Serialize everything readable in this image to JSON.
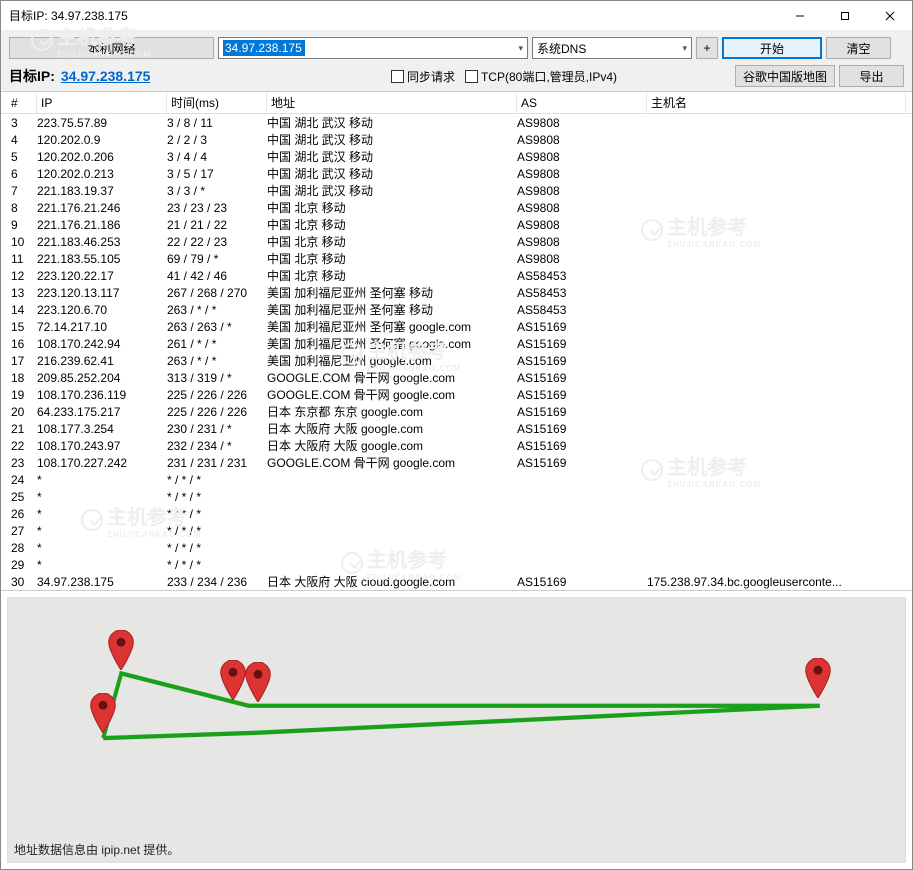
{
  "window": {
    "title": "目标IP: 34.97.238.175"
  },
  "toolbar": {
    "local_network": "本机网络",
    "target_input": "34.97.238.175",
    "dns_setting": "系统DNS",
    "start": "开始",
    "clear": "清空",
    "target_label": "目标IP:",
    "target_ip": "34.97.238.175",
    "sync_request": "同步请求",
    "tcp_option": "TCP(80端口,管理员,IPv4)",
    "google_map": "谷歌中国版地图",
    "export": "导出"
  },
  "columns": {
    "num": "#",
    "ip": "IP",
    "time": "时间(ms)",
    "addr": "地址",
    "as": "AS",
    "host": "主机名"
  },
  "rows": [
    {
      "n": "3",
      "ip": "223.75.57.89",
      "t": "3 / 8 / 11",
      "addr": "中国 湖北 武汉 移动",
      "as": "AS9808",
      "host": ""
    },
    {
      "n": "4",
      "ip": "120.202.0.9",
      "t": "2 / 2 / 3",
      "addr": "中国 湖北 武汉 移动",
      "as": "AS9808",
      "host": ""
    },
    {
      "n": "5",
      "ip": "120.202.0.206",
      "t": "3 / 4 / 4",
      "addr": "中国 湖北 武汉 移动",
      "as": "AS9808",
      "host": ""
    },
    {
      "n": "6",
      "ip": "120.202.0.213",
      "t": "3 / 5 / 17",
      "addr": "中国 湖北 武汉 移动",
      "as": "AS9808",
      "host": ""
    },
    {
      "n": "7",
      "ip": "221.183.19.37",
      "t": "3 / 3 / *",
      "addr": "中国 湖北 武汉 移动",
      "as": "AS9808",
      "host": ""
    },
    {
      "n": "8",
      "ip": "221.176.21.246",
      "t": "23 / 23 / 23",
      "addr": "中国 北京 移动",
      "as": "AS9808",
      "host": ""
    },
    {
      "n": "9",
      "ip": "221.176.21.186",
      "t": "21 / 21 / 22",
      "addr": "中国 北京 移动",
      "as": "AS9808",
      "host": ""
    },
    {
      "n": "10",
      "ip": "221.183.46.253",
      "t": "22 / 22 / 23",
      "addr": "中国 北京 移动",
      "as": "AS9808",
      "host": ""
    },
    {
      "n": "11",
      "ip": "221.183.55.105",
      "t": "69 / 79 / *",
      "addr": "中国 北京 移动",
      "as": "AS9808",
      "host": ""
    },
    {
      "n": "12",
      "ip": "223.120.22.17",
      "t": "41 / 42 / 46",
      "addr": "中国 北京 移动",
      "as": "AS58453",
      "host": ""
    },
    {
      "n": "13",
      "ip": "223.120.13.117",
      "t": "267 / 268 / 270",
      "addr": "美国 加利福尼亚州 圣何塞 移动",
      "as": "AS58453",
      "host": ""
    },
    {
      "n": "14",
      "ip": "223.120.6.70",
      "t": "263 / * / *",
      "addr": "美国 加利福尼亚州 圣何塞 移动",
      "as": "AS58453",
      "host": ""
    },
    {
      "n": "15",
      "ip": "72.14.217.10",
      "t": "263 / 263 / *",
      "addr": "美国 加利福尼亚州 圣何塞 google.com",
      "as": "AS15169",
      "host": ""
    },
    {
      "n": "16",
      "ip": "108.170.242.94",
      "t": "261 / * / *",
      "addr": "美国 加利福尼亚州 圣何塞 google.com",
      "as": "AS15169",
      "host": ""
    },
    {
      "n": "17",
      "ip": "216.239.62.41",
      "t": "263 / * / *",
      "addr": "美国 加利福尼亚州 google.com",
      "as": "AS15169",
      "host": ""
    },
    {
      "n": "18",
      "ip": "209.85.252.204",
      "t": "313 / 319 / *",
      "addr": "GOOGLE.COM 骨干网 google.com",
      "as": "AS15169",
      "host": ""
    },
    {
      "n": "19",
      "ip": "108.170.236.119",
      "t": "225 / 226 / 226",
      "addr": "GOOGLE.COM 骨干网 google.com",
      "as": "AS15169",
      "host": ""
    },
    {
      "n": "20",
      "ip": "64.233.175.217",
      "t": "225 / 226 / 226",
      "addr": "日本 东京都 东京 google.com",
      "as": "AS15169",
      "host": ""
    },
    {
      "n": "21",
      "ip": "108.177.3.254",
      "t": "230 / 231 / *",
      "addr": "日本 大阪府 大阪 google.com",
      "as": "AS15169",
      "host": ""
    },
    {
      "n": "22",
      "ip": "108.170.243.97",
      "t": "232 / 234 / *",
      "addr": "日本 大阪府 大阪 google.com",
      "as": "AS15169",
      "host": ""
    },
    {
      "n": "23",
      "ip": "108.170.227.242",
      "t": "231 / 231 / 231",
      "addr": "GOOGLE.COM 骨干网 google.com",
      "as": "AS15169",
      "host": ""
    },
    {
      "n": "24",
      "ip": "*",
      "t": "* / * / *",
      "addr": "",
      "as": "",
      "host": ""
    },
    {
      "n": "25",
      "ip": "*",
      "t": "* / * / *",
      "addr": "",
      "as": "",
      "host": ""
    },
    {
      "n": "26",
      "ip": "*",
      "t": "* / * / *",
      "addr": "",
      "as": "",
      "host": ""
    },
    {
      "n": "27",
      "ip": "*",
      "t": "* / * / *",
      "addr": "",
      "as": "",
      "host": ""
    },
    {
      "n": "28",
      "ip": "*",
      "t": "* / * / *",
      "addr": "",
      "as": "",
      "host": ""
    },
    {
      "n": "29",
      "ip": "*",
      "t": "* / * / *",
      "addr": "",
      "as": "",
      "host": ""
    },
    {
      "n": "30",
      "ip": "34.97.238.175",
      "t": "233 / 234 / 236",
      "addr": "日本 大阪府 大阪 cloud.google.com",
      "as": "AS15169",
      "host": "175.238.97.34.bc.googleuserconte..."
    }
  ],
  "map_footer": "地址数据信息由 ipip.net 提供。",
  "watermark_text": "主机参考",
  "watermark_sub": "ZHUJICANKAO.COM"
}
